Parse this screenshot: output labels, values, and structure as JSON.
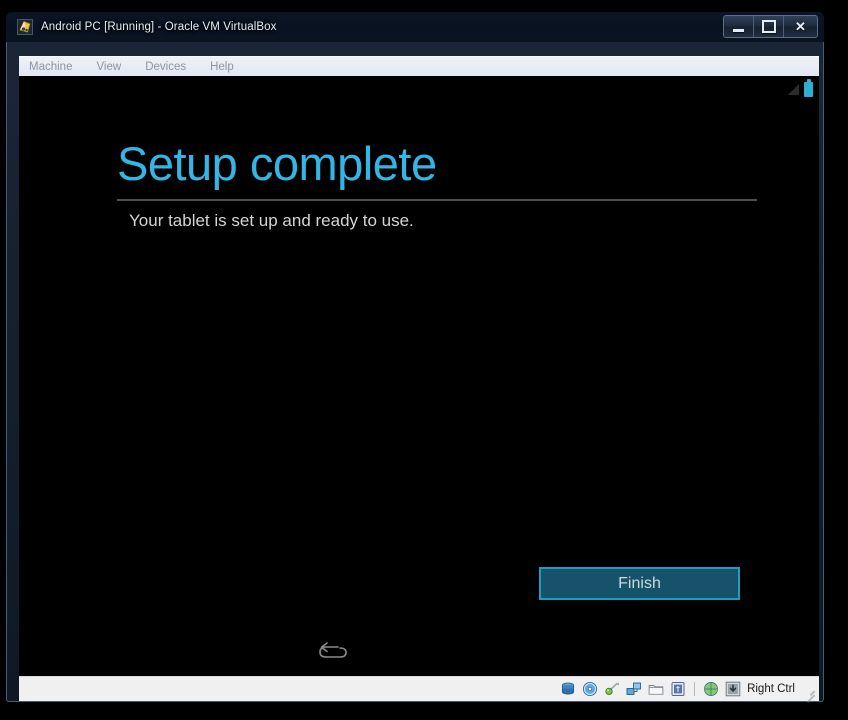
{
  "window": {
    "title": "Android PC [Running] - Oracle VM VirtualBox",
    "icon": "virtualbox-vm-icon",
    "controls": {
      "minimize_label": "Minimize",
      "maximize_label": "Maximize",
      "close_label": "Close",
      "close_glyph": "✕"
    }
  },
  "menubar": {
    "items": [
      {
        "label": "Machine"
      },
      {
        "label": "View"
      },
      {
        "label": "Devices"
      },
      {
        "label": "Help"
      }
    ]
  },
  "guest": {
    "statusbar": {
      "signal_icon": "signal-triangle-icon",
      "battery_icon": "battery-icon"
    },
    "wizard": {
      "title": "Setup complete",
      "subtitle": "Your tablet is set up and ready to use.",
      "finish_label": "Finish",
      "back_icon": "back-arrow-icon"
    }
  },
  "vbox_statusbar": {
    "icons": [
      {
        "name": "hard-disk-icon"
      },
      {
        "name": "optical-disk-icon"
      },
      {
        "name": "usb-icon"
      },
      {
        "name": "network-icon"
      },
      {
        "name": "shared-folders-icon"
      },
      {
        "name": "display-icon"
      },
      {
        "name": "remote-desktop-icon"
      },
      {
        "name": "mouse-capture-icon"
      }
    ],
    "host_key_label": "Right Ctrl"
  },
  "colors": {
    "android_accent": "#33b5e5",
    "button_fill": "#15536a",
    "button_border": "#1b9dc6",
    "guest_background": "#000000",
    "title_text": "#e8eef7"
  }
}
